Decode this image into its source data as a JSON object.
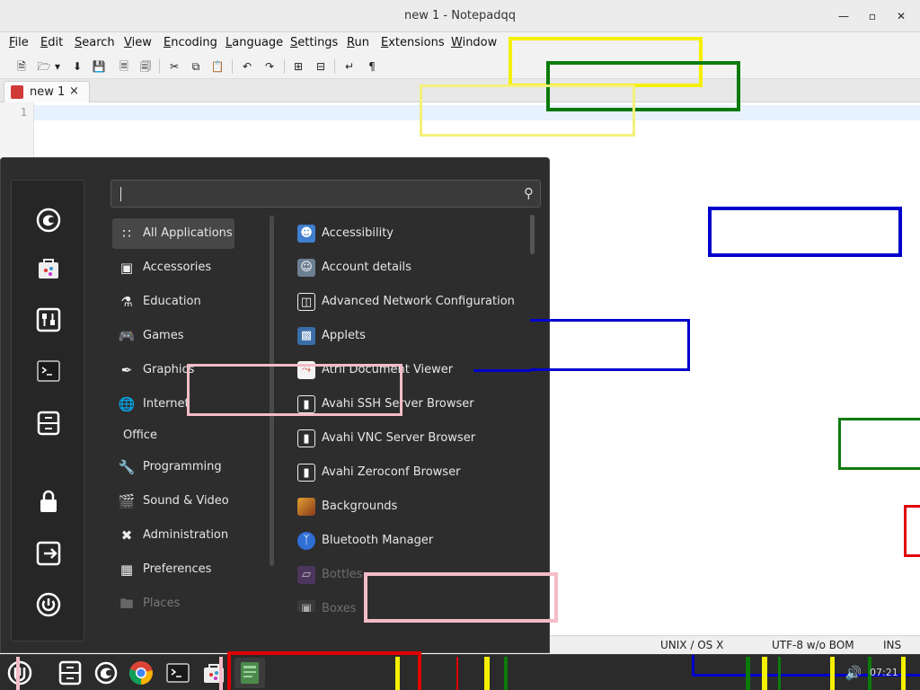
{
  "window": {
    "title": "new 1 - Notepadqq",
    "minimize_icon": "minimize-icon",
    "maximize_icon": "maximize-icon",
    "close_icon": "close-icon"
  },
  "menubar": {
    "items": [
      "File",
      "Edit",
      "Search",
      "View",
      "Encoding",
      "Language",
      "Settings",
      "Run",
      "Extensions",
      "Window"
    ]
  },
  "toolbar": {
    "icons": [
      "new-file-icon",
      "open-file-icon",
      "open-dropdown-icon",
      "save-icon",
      "save-all-icon",
      "close-icon",
      "close-all-icon",
      "cut-icon",
      "copy-icon",
      "paste-icon",
      "undo-icon",
      "redo-icon",
      "zoom-in-icon",
      "zoom-out-icon",
      "word-wrap-icon",
      "show-all-chars-icon"
    ]
  },
  "tabs": [
    {
      "label": "new 1",
      "close": "×"
    }
  ],
  "editor": {
    "line_numbers": [
      "1"
    ]
  },
  "statusbar": {
    "eol": "UNIX / OS X",
    "encoding": "UTF-8 w/o BOM",
    "mode": "INS"
  },
  "startmenu": {
    "search_placeholder": "",
    "favorites": [
      "firefox-icon",
      "software-manager-icon",
      "settings-icon",
      "terminal-icon",
      "files-icon",
      "lock-screen-icon",
      "logout-icon",
      "power-icon"
    ],
    "categories": [
      {
        "label": "All Applications",
        "icon": "grid-icon",
        "active": true
      },
      {
        "label": "Accessories",
        "icon": "toolbox-icon"
      },
      {
        "label": "Education",
        "icon": "flask-icon"
      },
      {
        "label": "Games",
        "icon": "gamepad-icon"
      },
      {
        "label": "Graphics",
        "icon": "brush-icon"
      },
      {
        "label": "Internet",
        "icon": "globe-icon"
      },
      {
        "label": "Office",
        "icon": ""
      },
      {
        "label": "Programming",
        "icon": "wrench-icon"
      },
      {
        "label": "Sound & Video",
        "icon": "media-icon"
      },
      {
        "label": "Administration",
        "icon": "tools-icon"
      },
      {
        "label": "Preferences",
        "icon": "preferences-icon"
      },
      {
        "label": "Places",
        "icon": "folder-icon",
        "faded": true
      }
    ],
    "apps": [
      {
        "label": "Accessibility",
        "icon": "accessibility-icon",
        "color": "#3f7fcf"
      },
      {
        "label": "Account details",
        "icon": "account-icon",
        "color": "#6d7f93"
      },
      {
        "label": "Advanced Network Configuration",
        "icon": "network-icon",
        "color": "#555555"
      },
      {
        "label": "Applets",
        "icon": "applets-icon",
        "color": "#3a6ea8"
      },
      {
        "label": "Atril Document Viewer",
        "icon": "atril-icon",
        "color": "#c94a3a"
      },
      {
        "label": "Avahi SSH Server Browser",
        "icon": "avahi-icon",
        "color": "#555555"
      },
      {
        "label": "Avahi VNC Server Browser",
        "icon": "avahi-icon",
        "color": "#555555"
      },
      {
        "label": "Avahi Zeroconf Browser",
        "icon": "avahi-icon",
        "color": "#555555"
      },
      {
        "label": "Backgrounds",
        "icon": "backgrounds-icon",
        "color": "#b36b2a"
      },
      {
        "label": "Bluetooth Manager",
        "icon": "bluetooth-icon",
        "color": "#2f6fd6"
      },
      {
        "label": "Bottles",
        "icon": "bottles-icon",
        "color": "#7a4e9c",
        "faded": true
      },
      {
        "label": "Boxes",
        "icon": "boxes-icon",
        "color": "#444444",
        "faded": true
      }
    ]
  },
  "taskbar": {
    "items": [
      "menu-icon",
      "files-icon",
      "firefox-icon",
      "chrome-icon",
      "terminal-icon",
      "software-manager-icon",
      "notepadqq-icon"
    ],
    "tray": {
      "volume_icon": "volume-icon",
      "clock": "07:21"
    }
  }
}
